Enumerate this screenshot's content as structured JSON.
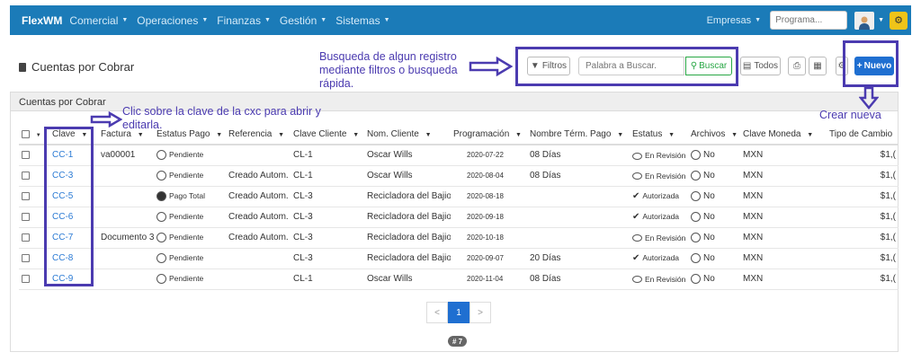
{
  "navbar": {
    "brand": "FlexWM",
    "menu": [
      "Comercial",
      "Operaciones",
      "Finanzas",
      "Gestión",
      "Sistemas"
    ],
    "empresas": "Empresas",
    "program_placeholder": "Programa..."
  },
  "page": {
    "title": "Cuentas por Cobrar",
    "panel_title": "Cuentas por Cobrar"
  },
  "toolbar": {
    "filtros": "Filtros",
    "search_placeholder": "Palabra a Buscar.",
    "buscar": "Buscar",
    "todos": "Todos",
    "nuevo": "Nuevo"
  },
  "table": {
    "columns": [
      "Clave",
      "Factura",
      "Estatus Pago",
      "Referencia",
      "Clave Cliente",
      "Nom. Cliente",
      "Programación",
      "Nombre Térm. Pago",
      "Estatus",
      "Archivos",
      "Clave Moneda",
      "Tipo de Cambio"
    ],
    "rows": [
      {
        "clave": "CC-1",
        "factura": "va00001",
        "estatus_pago": "Pendiente",
        "pago_icon": "open",
        "referencia": "",
        "clave_cliente": "CL-1",
        "nom_cliente": "Oscar Wills",
        "programacion": "2020-07-22",
        "termino": "08 Días",
        "estatus": "En Revisión",
        "estatus_icon": "bubble",
        "archivos": "No",
        "moneda": "MXN",
        "tipo_cambio": "$1,("
      },
      {
        "clave": "CC-3",
        "factura": "",
        "estatus_pago": "Pendiente",
        "pago_icon": "open",
        "referencia": "Creado Autom.",
        "clave_cliente": "CL-1",
        "nom_cliente": "Oscar Wills",
        "programacion": "2020-08-04",
        "termino": "08 Días",
        "estatus": "En Revisión",
        "estatus_icon": "bubble",
        "archivos": "No",
        "moneda": "MXN",
        "tipo_cambio": "$1,("
      },
      {
        "clave": "CC-5",
        "factura": "",
        "estatus_pago": "Pago Total",
        "pago_icon": "filled",
        "referencia": "Creado Autom.",
        "clave_cliente": "CL-3",
        "nom_cliente": "Recicladora del Bajio",
        "programacion": "2020-08-18",
        "termino": "",
        "estatus": "Autorizada",
        "estatus_icon": "check",
        "archivos": "No",
        "moneda": "MXN",
        "tipo_cambio": "$1,("
      },
      {
        "clave": "CC-6",
        "factura": "",
        "estatus_pago": "Pendiente",
        "pago_icon": "open",
        "referencia": "Creado Autom.",
        "clave_cliente": "CL-3",
        "nom_cliente": "Recicladora del Bajio",
        "programacion": "2020-09-18",
        "termino": "",
        "estatus": "Autorizada",
        "estatus_icon": "check",
        "archivos": "No",
        "moneda": "MXN",
        "tipo_cambio": "$1,("
      },
      {
        "clave": "CC-7",
        "factura": "Documento 3",
        "estatus_pago": "Pendiente",
        "pago_icon": "open",
        "referencia": "Creado Autom.",
        "clave_cliente": "CL-3",
        "nom_cliente": "Recicladora del Bajio",
        "programacion": "2020-10-18",
        "termino": "",
        "estatus": "En Revisión",
        "estatus_icon": "bubble",
        "archivos": "No",
        "moneda": "MXN",
        "tipo_cambio": "$1,("
      },
      {
        "clave": "CC-8",
        "factura": "",
        "estatus_pago": "Pendiente",
        "pago_icon": "open",
        "referencia": "",
        "clave_cliente": "CL-3",
        "nom_cliente": "Recicladora del Bajio",
        "programacion": "2020-09-07",
        "termino": "20 Días",
        "estatus": "Autorizada",
        "estatus_icon": "check",
        "archivos": "No",
        "moneda": "MXN",
        "tipo_cambio": "$1,("
      },
      {
        "clave": "CC-9",
        "factura": "",
        "estatus_pago": "Pendiente",
        "pago_icon": "open",
        "referencia": "",
        "clave_cliente": "CL-1",
        "nom_cliente": "Oscar Wills",
        "programacion": "2020-11-04",
        "termino": "08 Días",
        "estatus": "En Revisión",
        "estatus_icon": "bubble",
        "archivos": "No",
        "moneda": "MXN",
        "tipo_cambio": "$1,("
      }
    ]
  },
  "pagination": {
    "prev": "<",
    "current": "1",
    "next": ">",
    "count": "# 7"
  },
  "annotations": {
    "search": "Busqueda de algun registro mediante filtros o busqueda rápida.",
    "clave": "Clic sobre la clave de la cxc para abrir y editarla.",
    "nuevo": "Crear nueva"
  },
  "colors": {
    "navbar": "#1b7bb8",
    "annotation": "#4b3bb0",
    "primary": "#1f6fd1",
    "success": "#28a745",
    "link": "#2a7ad4"
  }
}
